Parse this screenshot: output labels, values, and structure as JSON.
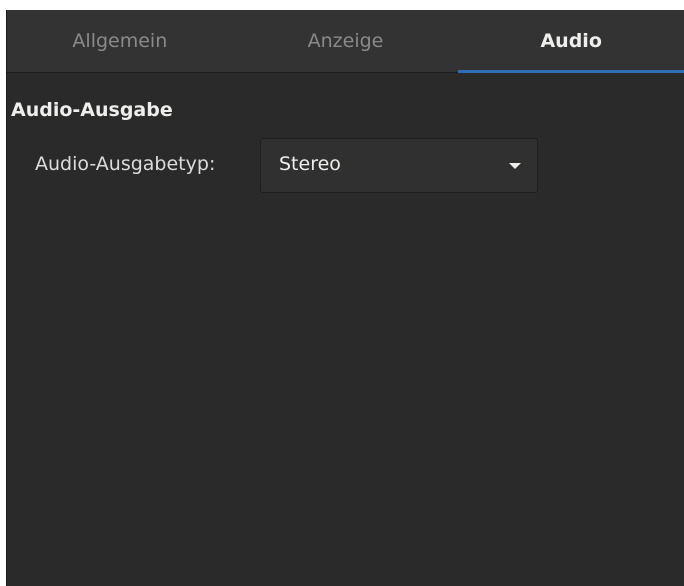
{
  "tabs": [
    {
      "label": "Allgemein",
      "active": false
    },
    {
      "label": "Anzeige",
      "active": false
    },
    {
      "label": "Audio",
      "active": true
    }
  ],
  "section": {
    "title": "Audio-Ausgabe",
    "output_type": {
      "label": "Audio-Ausgabetyp:",
      "selected": "Stereo",
      "icon": "chevron-down-icon"
    }
  },
  "colors": {
    "background": "#2a2a2a",
    "tabbar": "#333333",
    "accent": "#2f6db5",
    "text": "#eeeeec",
    "inactive_text": "#8a8a8a"
  }
}
